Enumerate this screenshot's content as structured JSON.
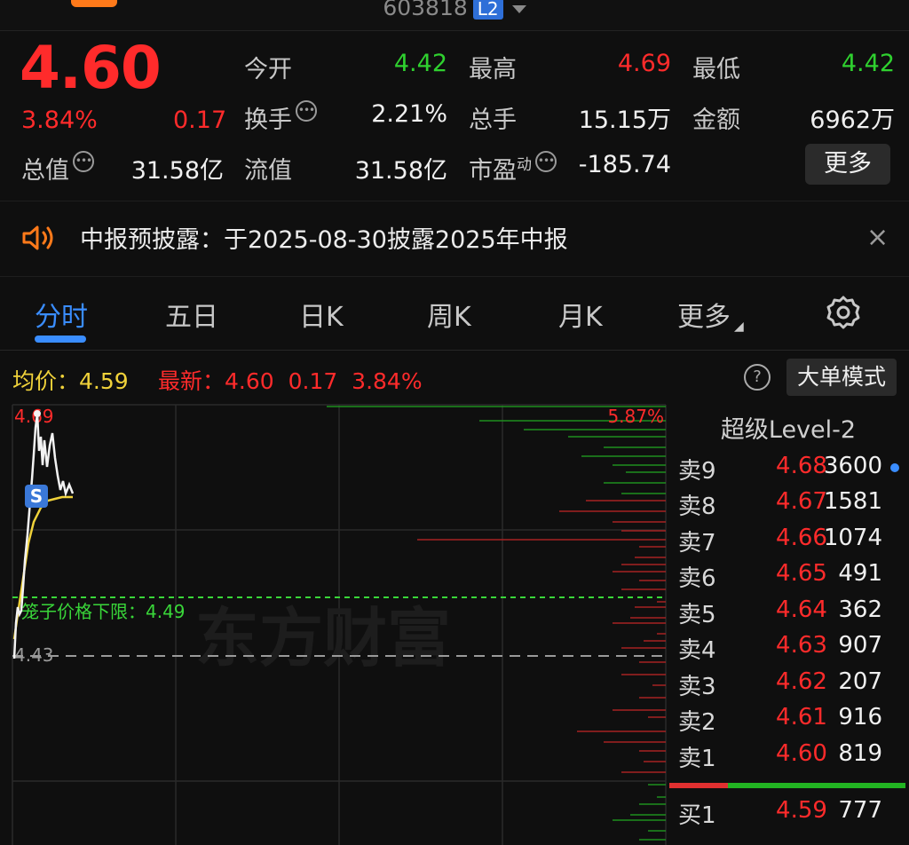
{
  "header": {
    "code": "603818",
    "badge": "L2"
  },
  "quote": {
    "price": "4.60",
    "change_pct": "3.84%",
    "change": "0.17",
    "rows": [
      [
        {
          "label": "今开",
          "value": "4.42",
          "color": "green"
        },
        {
          "label": "最高",
          "value": "4.69",
          "color": "red"
        },
        {
          "label": "最低",
          "value": "4.42",
          "color": "green"
        }
      ],
      [
        {
          "label": "换手",
          "value": "2.21%",
          "color": "white",
          "info": true
        },
        {
          "label": "总手",
          "value": "15.15万",
          "color": "white"
        },
        {
          "label": "金额",
          "value": "6962万",
          "color": "white"
        }
      ]
    ],
    "total_value_label": "总值",
    "total_value": "31.58亿",
    "float_value_label": "流值",
    "float_value": "31.58亿",
    "pe_label": "市盈",
    "pe_sup": "动",
    "pe_value": "-185.74",
    "more_label": "更多"
  },
  "notice": {
    "text": "中报预披露：于2025-08-30披露2025年中报",
    "icon": "speaker-icon",
    "close": "×"
  },
  "tabs": [
    "分时",
    "五日",
    "日K",
    "周K",
    "月K",
    "更多"
  ],
  "active_tab": "分时",
  "info_bar": {
    "avg_label": "均价：4.59",
    "latest_label": "最新：",
    "latest_price": "4.60",
    "latest_change": "0.17",
    "latest_pct": "3.84%",
    "help": "?",
    "big_order_button": "大单模式"
  },
  "chart_labels": {
    "high_price": "4.69",
    "upper_pct": "5.87%",
    "base_price": "4.43",
    "lower_limit_label": "笼子价格下限：4.49",
    "marker": "S",
    "watermark": "东方财富"
  },
  "order_book": {
    "title": "超级Level-2",
    "asks": [
      {
        "label": "卖9",
        "price": "4.68",
        "qty": "3600"
      },
      {
        "label": "卖8",
        "price": "4.67",
        "qty": "1581"
      },
      {
        "label": "卖7",
        "price": "4.66",
        "qty": "1074"
      },
      {
        "label": "卖6",
        "price": "4.65",
        "qty": "491"
      },
      {
        "label": "卖5",
        "price": "4.64",
        "qty": "362"
      },
      {
        "label": "卖4",
        "price": "4.63",
        "qty": "907"
      },
      {
        "label": "卖3",
        "price": "4.62",
        "qty": "207"
      },
      {
        "label": "卖2",
        "price": "4.61",
        "qty": "916"
      },
      {
        "label": "卖1",
        "price": "4.60",
        "qty": "819"
      }
    ],
    "bids": [
      {
        "label": "买1",
        "price": "4.59",
        "qty": "777"
      }
    ]
  },
  "colors": {
    "up": "#ff2b2b",
    "down": "#2fd12f",
    "accent": "#3a8dff",
    "avg_line": "#f0d23a"
  }
}
